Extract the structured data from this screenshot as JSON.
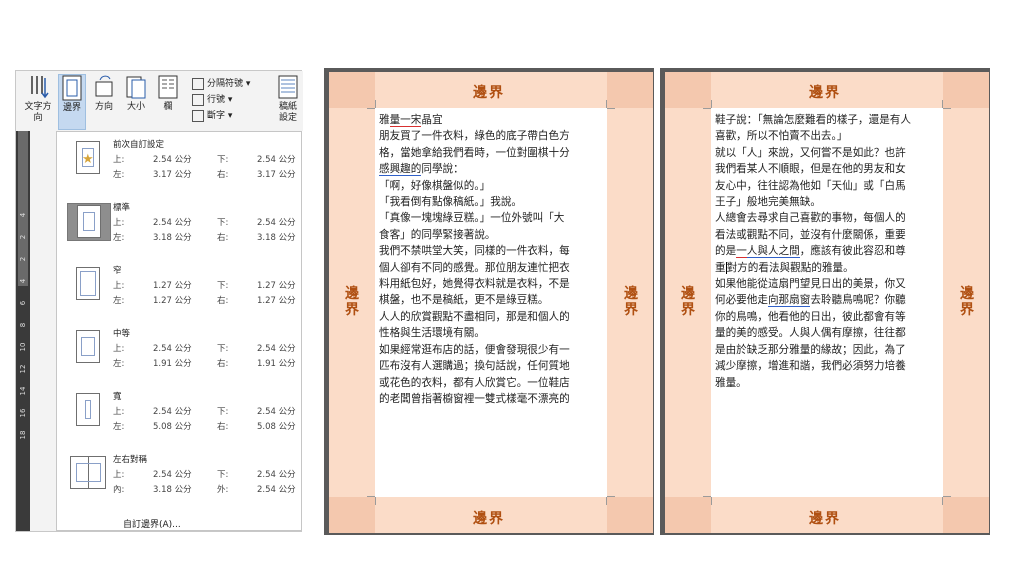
{
  "ribbon": {
    "text_direction": "文字方\n向",
    "margins": "邊界",
    "orientation": "方向",
    "size": "大小",
    "columns": "欄",
    "breaks": "分隔符號",
    "line_numbers": "行號",
    "hyphenation": "斷字",
    "page_setup": "稿紙\n設定"
  },
  "dropdown": {
    "presets": [
      {
        "name": "前次自訂設定",
        "l1a": "上:",
        "l1b": "2.54 公分",
        "l1c": "下:",
        "l1d": "2.54 公分",
        "l2a": "左:",
        "l2b": "3.17 公分",
        "l2c": "右:",
        "l2d": "3.17 公分",
        "icon": "star-icon"
      },
      {
        "name": "標準",
        "l1a": "上:",
        "l1b": "2.54 公分",
        "l1c": "下:",
        "l1d": "2.54 公分",
        "l2a": "左:",
        "l2b": "3.18 公分",
        "l2c": "右:",
        "l2d": "3.18 公分"
      },
      {
        "name": "窄",
        "l1a": "上:",
        "l1b": "1.27 公分",
        "l1c": "下:",
        "l1d": "1.27 公分",
        "l2a": "左:",
        "l2b": "1.27 公分",
        "l2c": "右:",
        "l2d": "1.27 公分"
      },
      {
        "name": "中等",
        "l1a": "上:",
        "l1b": "2.54 公分",
        "l1c": "下:",
        "l1d": "2.54 公分",
        "l2a": "左:",
        "l2b": "1.91 公分",
        "l2c": "右:",
        "l2d": "1.91 公分"
      },
      {
        "name": "寬",
        "l1a": "上:",
        "l1b": "2.54 公分",
        "l1c": "下:",
        "l1d": "2.54 公分",
        "l2a": "左:",
        "l2b": "5.08 公分",
        "l2c": "右:",
        "l2d": "5.08 公分"
      },
      {
        "name": "左右對稱",
        "l1a": "上:",
        "l1b": "2.54 公分",
        "l1c": "下:",
        "l1d": "2.54 公分",
        "l2a": "內:",
        "l2b": "3.18 公分",
        "l2c": "外:",
        "l2d": "2.54 公分"
      }
    ],
    "custom": "自訂邊界(A)..."
  },
  "ruler": [
    "4",
    "2",
    "2",
    "4",
    "6",
    "8",
    "10",
    "12",
    "14",
    "16",
    "18"
  ],
  "margin_label": "邊界",
  "margin_label_v": "邊\n界",
  "page1_lines": [
    "雅量一宋晶宜",
    "朋友買了一件衣料，綠色的底子帶白色方",
    "格，當她拿給我們看時，一位對圍棋十分",
    "感興趣的同學說：",
    "「啊，好像棋盤似的。」",
    "「我看倒有點像稿紙。」我說。",
    "「真像一塊塊綠豆糕。」一位外號叫「大",
    "食客」的同學緊接著說。",
    "我們不禁哄堂大笑，同樣的一件衣料，每",
    "個人卻有不同的感覺。那位朋友連忙把衣",
    "料用紙包好，她覺得衣料就是衣料，不是",
    "棋盤，也不是稿紙，更不是綠豆糕。",
    "人人的欣賞觀點不盡相同，那是和個人的",
    "性格與生活環境有關。",
    "如果經常逛布店的話，便會發現很少有一",
    "匹布沒有人選購過；換句話說，任何質地",
    "或花色的衣料，都有人欣賞它。一位鞋店",
    "的老闆曾指著櫥窗裡一雙式樣毫不漂亮的"
  ],
  "page2_lines": [
    "鞋子說：「無論怎麼難看的樣子，還是有人",
    "喜歡，所以不怕賣不出去。」",
    "就以「人」來說，又何嘗不是如此？也許",
    "我們看某人不順眼，但是在他的男友和女",
    "友心中，往往認為他如「天仙」或「白馬",
    "王子」般地完美無缺。",
    "人總會去尋求自己喜歡的事物，每個人的",
    "看法或觀點不同，並沒有什麼關係，重要",
    "的是一人與人之間，應該有彼此容忍和尊",
    "重對方的看法與觀點的雅量。",
    "如果他能從這扇門望見日出的美景，你又",
    "何必要他走向那扇窗去聆聽鳥鳴呢？你聽",
    "你的鳥鳴，他看他的日出，彼此都會有等",
    "量的美的感受。人與人偶有摩擦，往往都",
    "是由於缺乏那分雅量的緣故；因此，為了",
    "減少摩擦，增進和諧，我們必須努力培養",
    "雅量。"
  ]
}
